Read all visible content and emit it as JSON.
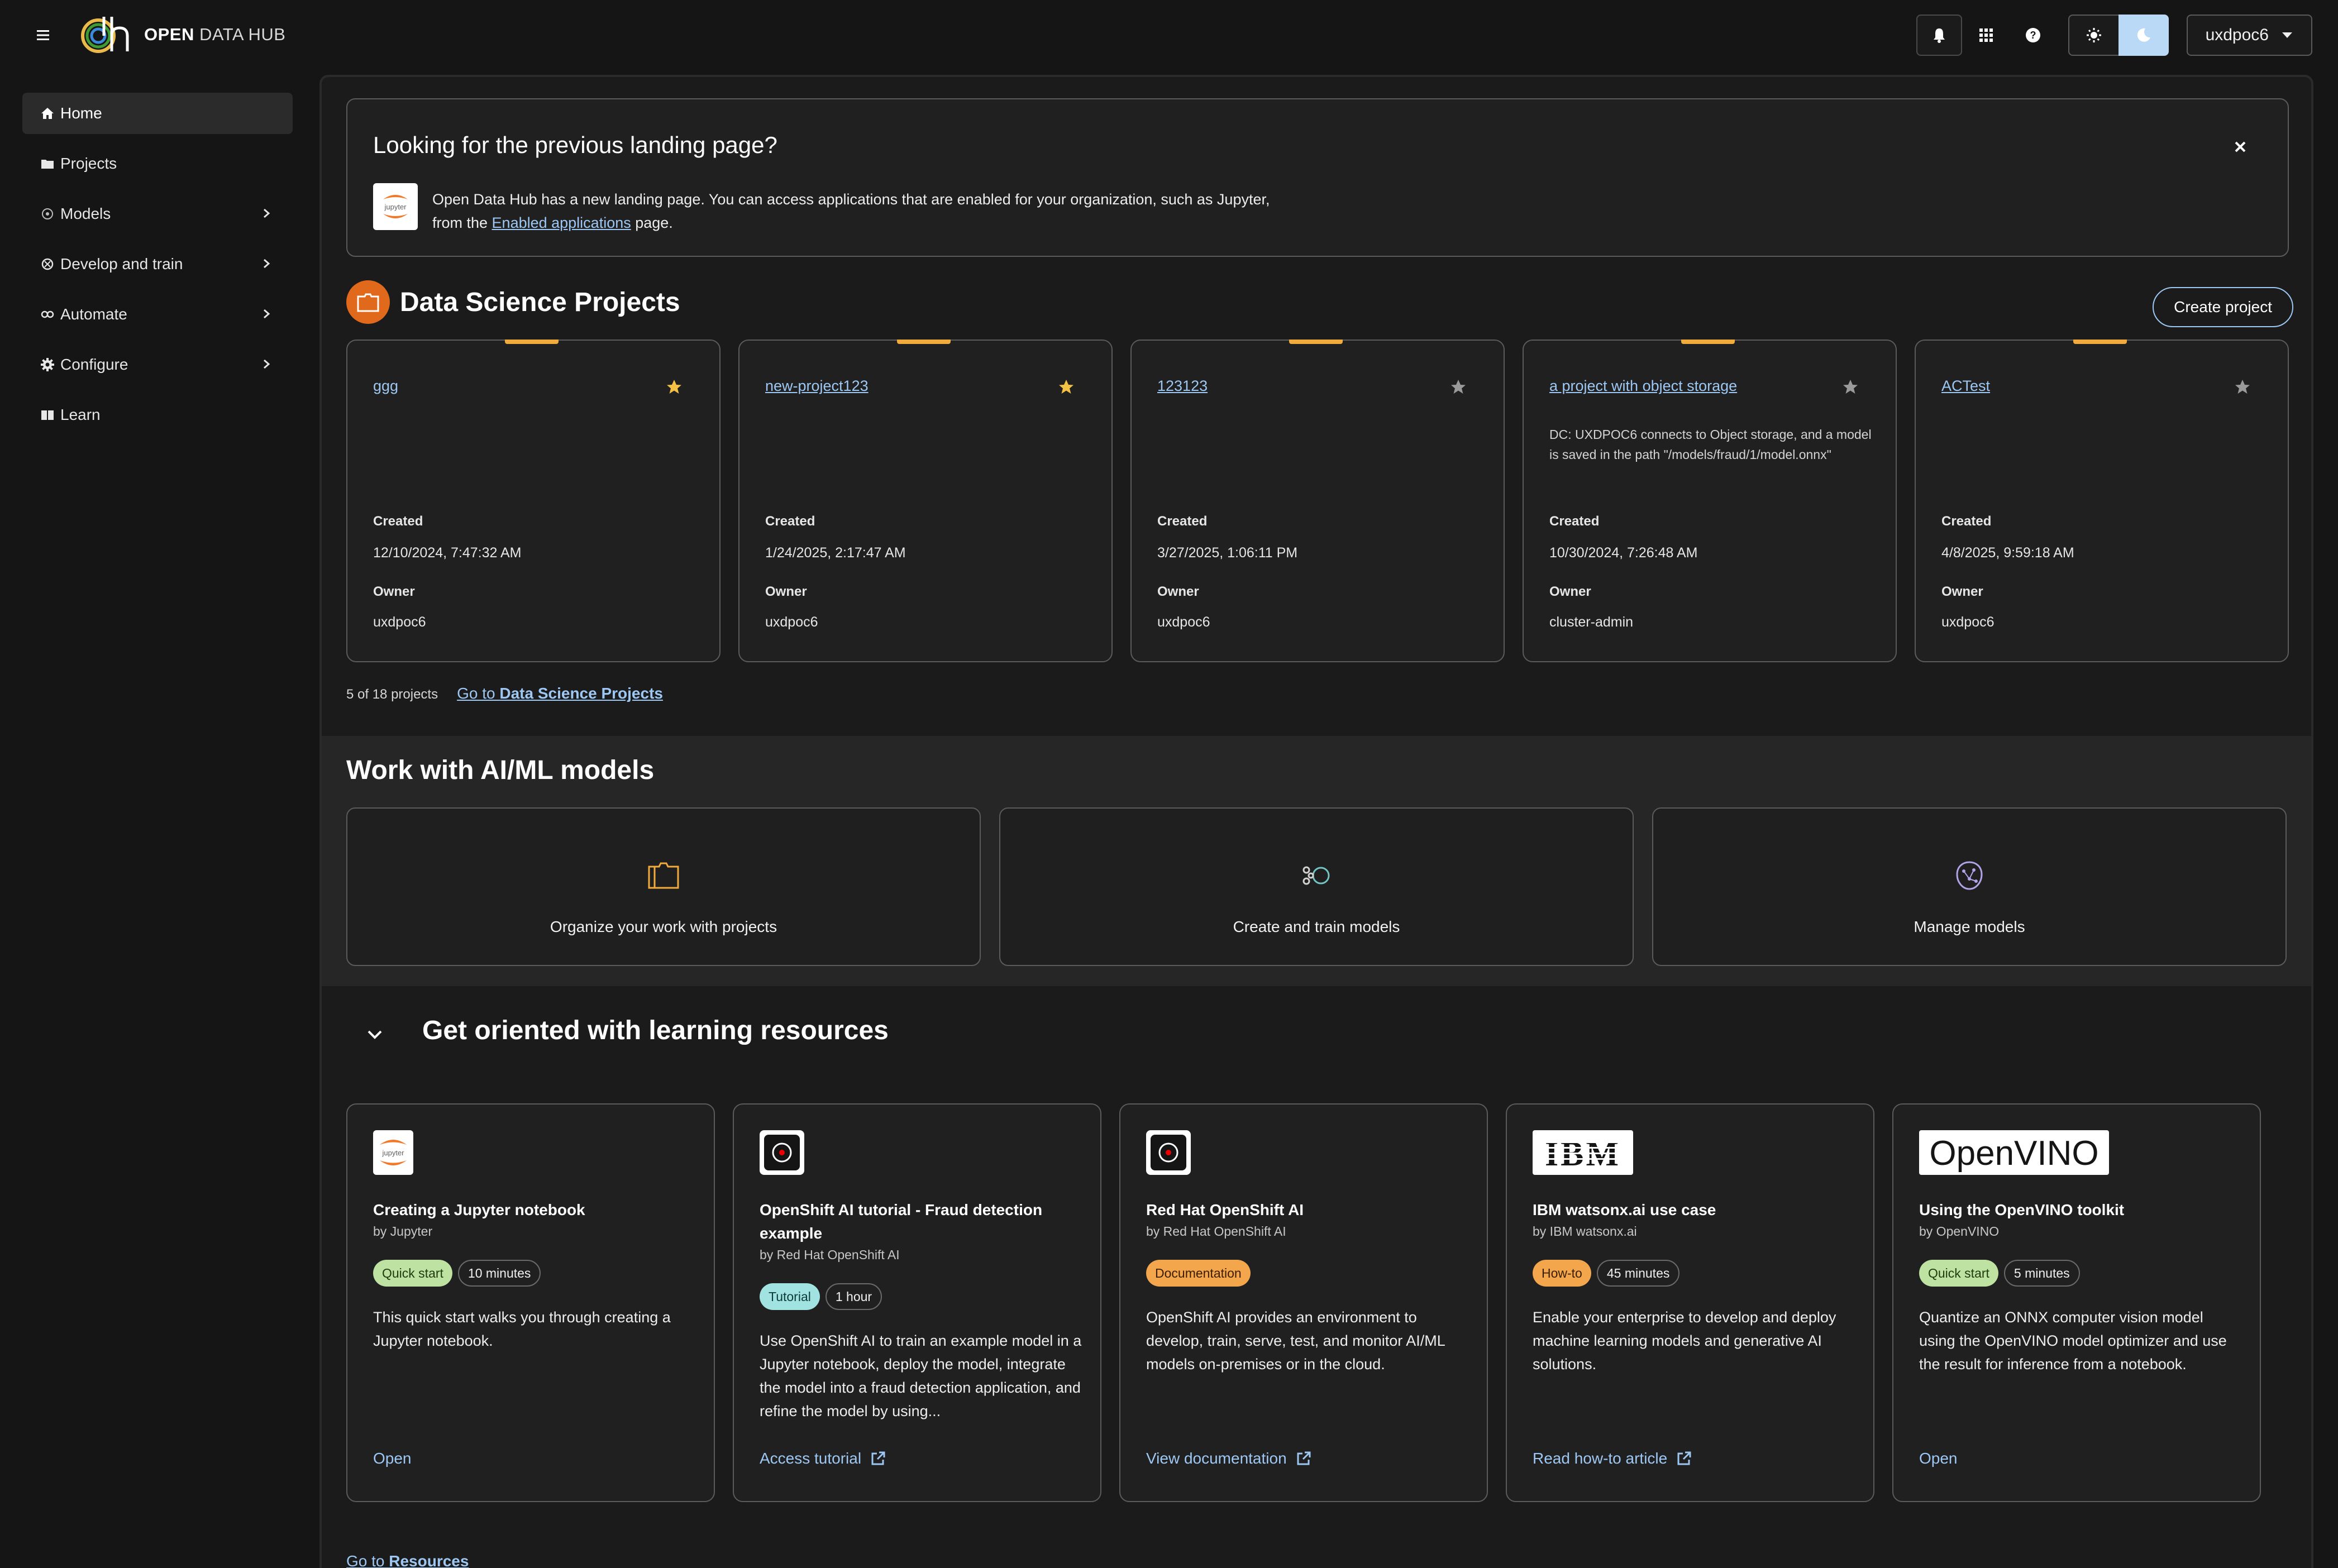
{
  "brand": {
    "bold": "OPEN",
    "rest": " DATA HUB"
  },
  "user": {
    "name": "uxdpoc6"
  },
  "sidebar": {
    "items": [
      {
        "label": "Home",
        "icon": "home-icon",
        "active": true,
        "expandable": false
      },
      {
        "label": "Projects",
        "icon": "folder-icon",
        "active": false,
        "expandable": false
      },
      {
        "label": "Models",
        "icon": "models-icon",
        "active": false,
        "expandable": true
      },
      {
        "label": "Develop and train",
        "icon": "develop-icon",
        "active": false,
        "expandable": true
      },
      {
        "label": "Automate",
        "icon": "automate-icon",
        "active": false,
        "expandable": true
      },
      {
        "label": "Configure",
        "icon": "gear-icon",
        "active": false,
        "expandable": true
      },
      {
        "label": "Learn",
        "icon": "book-icon",
        "active": false,
        "expandable": false
      }
    ]
  },
  "alert": {
    "title": "Looking for the previous landing page?",
    "body_1": "Open Data Hub has a new landing page. You can access applications that are enabled for your organization, such as Jupyter,",
    "body_2": "from the ",
    "link": "Enabled applications",
    "body_3": " page."
  },
  "projects": {
    "title": "Data Science Projects",
    "create_label": "Create project",
    "created_label": "Created",
    "owner_label": "Owner",
    "items": [
      {
        "name": "ggg",
        "starred": true,
        "description": "",
        "created": "12/10/2024, 7:47:32 AM",
        "owner": "uxdpoc6"
      },
      {
        "name": "new-project123",
        "starred": true,
        "description": "",
        "created": "1/24/2025, 2:17:47 AM",
        "owner": "uxdpoc6"
      },
      {
        "name": "123123",
        "starred": false,
        "description": "",
        "created": "3/27/2025, 1:06:11 PM",
        "owner": "uxdpoc6"
      },
      {
        "name": "a project with object storage",
        "starred": false,
        "description": "DC: UXDPOC6 connects to Object storage, and a model is saved in the path \"/models/fraud/1/model.onnx\"",
        "created": "10/30/2024, 7:26:48 AM",
        "owner": "cluster-admin"
      },
      {
        "name": "ACTest",
        "starred": false,
        "description": "",
        "created": "4/8/2025, 9:59:18 AM",
        "owner": "uxdpoc6"
      }
    ],
    "count_text": "5 of 18 projects",
    "go_prefix": "Go to ",
    "go_bold": "Data Science Projects"
  },
  "ml": {
    "title": "Work with AI/ML models",
    "cards": [
      {
        "label": "Organize your work with projects",
        "icon": "folder-outline-icon"
      },
      {
        "label": "Create and train models",
        "icon": "train-models-icon"
      },
      {
        "label": "Manage models",
        "icon": "brain-icon"
      }
    ]
  },
  "learning": {
    "title": "Get oriented with learning resources",
    "resources": [
      {
        "title": "Creating a Jupyter notebook",
        "by": "by Jupyter",
        "type": "Quick start",
        "duration": "10 minutes",
        "description": "This quick start walks you through creating a Jupyter notebook.",
        "action": "Open",
        "external": false,
        "logo": "jupyter-logo"
      },
      {
        "title": "OpenShift AI tutorial - Fraud detection example",
        "by": "by Red Hat OpenShift AI",
        "type": "Tutorial",
        "duration": "1 hour",
        "description": "Use OpenShift AI to train an example model in a Jupyter notebook, deploy the model, integrate the model into a fraud detection application, and refine the model by using...",
        "action": "Access tutorial",
        "external": true,
        "logo": "openshift-ai-logo"
      },
      {
        "title": "Red Hat OpenShift AI",
        "by": "by Red Hat OpenShift AI",
        "type": "Documentation",
        "duration": "",
        "description": "OpenShift AI provides an environment to develop, train, serve, test, and monitor AI/ML models on-premises or in the cloud.",
        "action": "View documentation",
        "external": true,
        "logo": "openshift-ai-logo"
      },
      {
        "title": "IBM watsonx.ai use case",
        "by": "by IBM watsonx.ai",
        "type": "How-to",
        "duration": "45 minutes",
        "description": "Enable your enterprise to develop and deploy machine learning models and generative AI solutions.",
        "action": "Read how-to article",
        "external": true,
        "logo": "ibm-logo"
      },
      {
        "title": "Using the OpenVINO toolkit",
        "by": "by OpenVINO",
        "type": "Quick start",
        "duration": "5 minutes",
        "description": "Quantize an ONNX computer vision model using the OpenVINO model optimizer and use the result for inference from a notebook.",
        "action": "Open",
        "external": false,
        "logo": "openvino-logo"
      }
    ],
    "go_prefix": "Go to ",
    "go_bold": "Resources"
  },
  "logo_text": {
    "jupyter": "jupyter",
    "ibm": "IBM",
    "openvino": "OpenVINO"
  }
}
